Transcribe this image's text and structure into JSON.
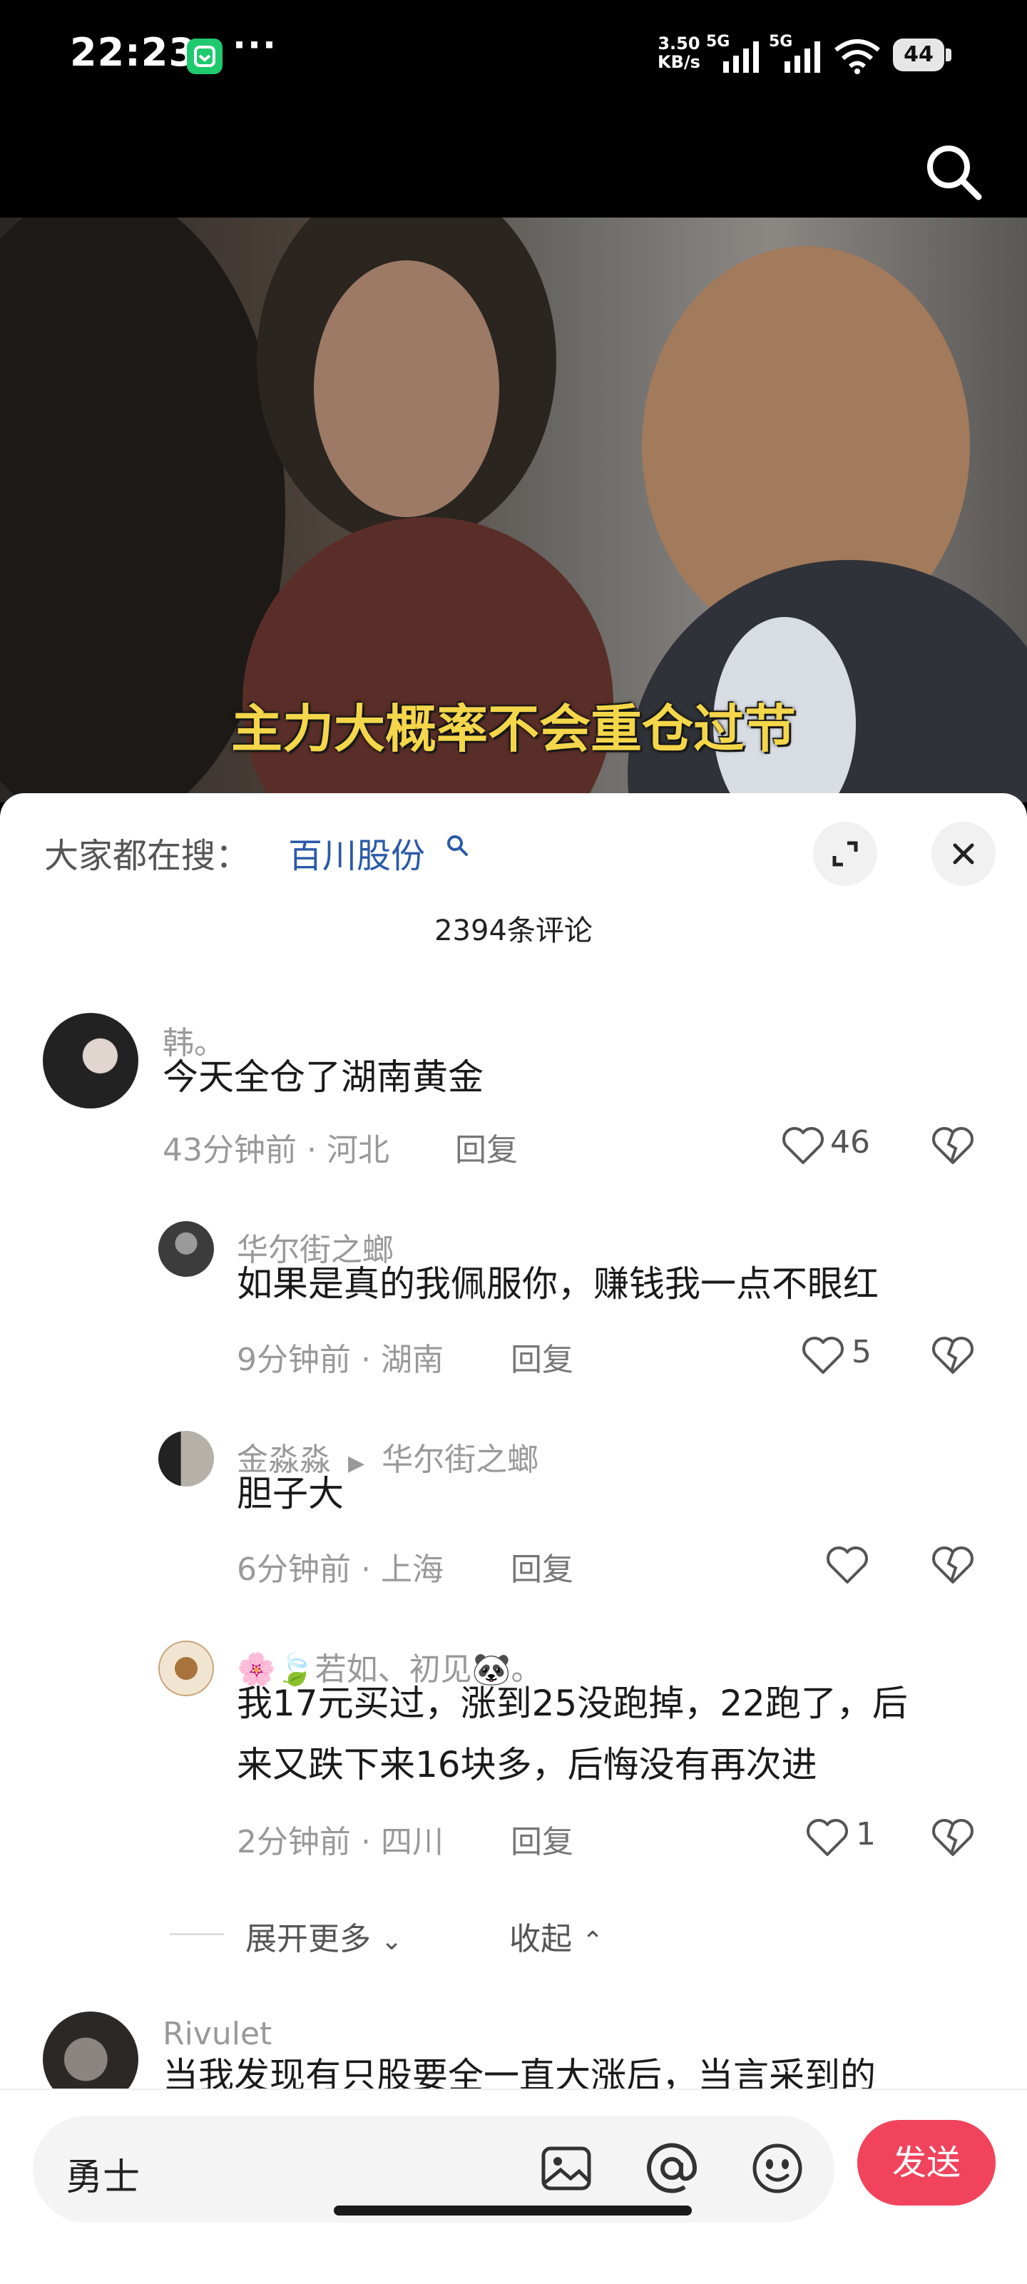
{
  "status_bar": {
    "time": "22:23",
    "more": "···",
    "net_speed_value": "3.50",
    "net_speed_unit": "KB/s",
    "signal1_label": "5G",
    "signal2_label": "5G",
    "battery": "44"
  },
  "video": {
    "subtitle": "主力大概率不会重仓过节"
  },
  "panel": {
    "search_prefix": "大家都在搜：",
    "search_term": "百川股份",
    "comment_count": "2394条评论",
    "comments": [
      {
        "name": "韩。",
        "text": "今天全仓了湖南黄金",
        "meta": "43分钟前 · 河北",
        "reply": "回复",
        "likes": "46"
      },
      {
        "name": "华尔街之螂",
        "text": "如果是真的我佩服你，赚钱我一点不眼红",
        "meta": "9分钟前 · 湖南",
        "reply": "回复",
        "likes": "5"
      },
      {
        "name": "金淼淼",
        "reply_to": "华尔街之螂",
        "text": "胆子大",
        "meta": "6分钟前 · 上海",
        "reply": "回复",
        "likes": ""
      },
      {
        "name": "🌸🍃若如、初见🐼。",
        "text_line1": "我17元买过，涨到25没跑掉，22跑了，后",
        "text_line2": "来又跌下来16块多，后悔没有再次进",
        "meta": "2分钟前 · 四川",
        "reply": "回复",
        "likes": "1"
      },
      {
        "name": "Rivulet",
        "text": "当我发现有只股要全一直大涨后，当言采到的"
      }
    ],
    "expand_more": "展开更多",
    "collapse": "收起"
  },
  "input_bar": {
    "placeholder": "勇士",
    "send_label": "发送"
  }
}
